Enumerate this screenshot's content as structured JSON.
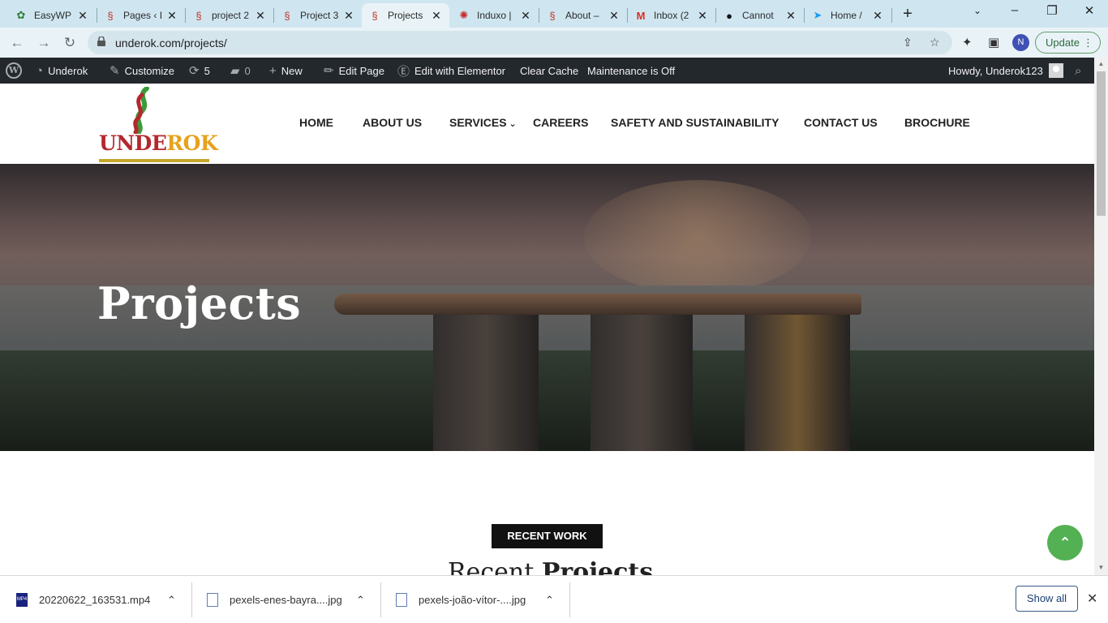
{
  "browser": {
    "tabs": [
      {
        "title": "EasyWP",
        "icon": "easywp-icon"
      },
      {
        "title": "Pages ‹ I",
        "icon": "underok-favicon"
      },
      {
        "title": "project 2",
        "icon": "underok-favicon"
      },
      {
        "title": "Project 3",
        "icon": "underok-favicon"
      },
      {
        "title": "Projects",
        "icon": "underok-favicon",
        "active": true
      },
      {
        "title": "Induxo |",
        "icon": "induxo-icon"
      },
      {
        "title": "About –",
        "icon": "underok-favicon"
      },
      {
        "title": "Inbox (2",
        "icon": "gmail-icon"
      },
      {
        "title": "Cannot",
        "icon": "github-icon"
      },
      {
        "title": "Home /",
        "icon": "twitter-icon"
      }
    ],
    "url": "underok.com/projects/",
    "profile_initial": "N",
    "update_label": "Update"
  },
  "admin_bar": {
    "site_name": "Underok",
    "customize": "Customize",
    "updates_count": "5",
    "comments_count": "0",
    "new": "New",
    "edit_page": "Edit Page",
    "elementor": "Edit with Elementor",
    "clear_cache": "Clear Cache",
    "maintenance": "Maintenance is Off",
    "howdy": "Howdy, Underok123"
  },
  "site": {
    "logo_text_1": "UNDE",
    "logo_text_2": "ROK",
    "nav": {
      "home": "HOME",
      "about": "ABOUT US",
      "services": "SERVICES",
      "careers": "CAREERS",
      "safety": "SAFETY AND SUSTAINABILITY",
      "contact": "CONTACT US",
      "brochure": "BROCHURE"
    },
    "hero_title": "Projects",
    "badge": "RECENT WORK",
    "section_title_1": "Recent ",
    "section_title_2": "Projects"
  },
  "downloads": {
    "items": [
      {
        "name": "20220622_163531.mp4",
        "type": "mp4"
      },
      {
        "name": "pexels-enes-bayra....jpg",
        "type": "jpg"
      },
      {
        "name": "pexels-joão-vítor-....jpg",
        "type": "jpg"
      }
    ],
    "show_all": "Show all"
  },
  "colors": {
    "tabstrip": "#cfe6f1",
    "admin_bar": "#23282d",
    "brand_red": "#b3282d",
    "brand_gold": "#e6a21d",
    "scroll_top_green": "#53b153"
  }
}
